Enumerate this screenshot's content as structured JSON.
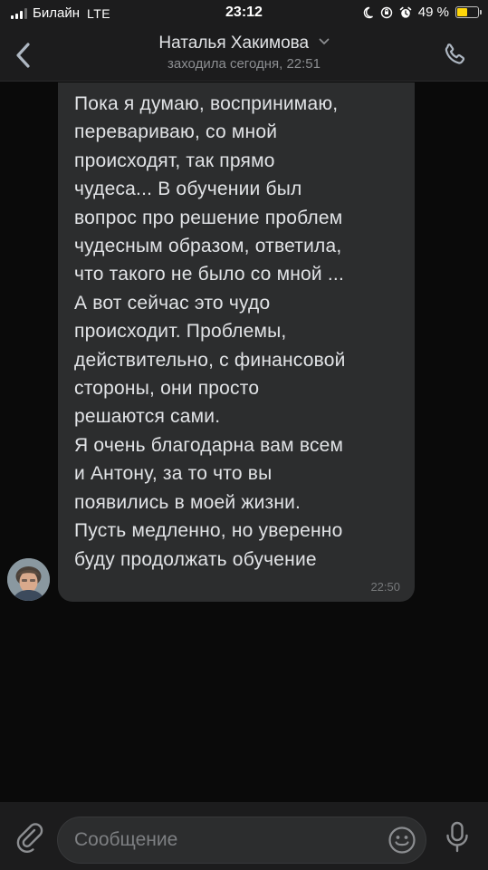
{
  "status_bar": {
    "carrier": "Билайн",
    "network": "LTE",
    "time": "23:12",
    "battery_percent": "49 %",
    "battery_level": 0.49,
    "battery_color": "#ffd60a"
  },
  "header": {
    "contact_name": "Наталья Хакимова",
    "last_seen": "заходила сегодня, 22:51",
    "back_icon": "chevron-left-icon",
    "call_icon": "phone-icon"
  },
  "message": {
    "lines": [
      "Пока я думаю, воспринимаю,",
      "перевариваю, со мной",
      "происходят, так прямо",
      "чудеса... В обучении был",
      "вопрос про решение проблем",
      "чудесным образом, ответила,",
      "что такого не было со мной ...",
      "А вот сейчас это чудо",
      "происходит. Проблемы,",
      "действительно, с финансовой",
      "стороны, они просто",
      "решаются сами.",
      "Я очень благодарна вам всем",
      "и Антону, за то что вы",
      "появились в моей жизни.",
      "Пусть медленно, но уверенно",
      "буду продолжать обучение"
    ],
    "time": "22:50"
  },
  "composer": {
    "placeholder": "Сообщение",
    "attach_icon": "paperclip-icon",
    "emoji_icon": "smile-icon",
    "mic_icon": "microphone-icon"
  },
  "colors": {
    "background": "#0a0a0a",
    "panel": "#1c1c1d",
    "bubble": "#2c2d2e",
    "accent": "#aeb7c2"
  }
}
